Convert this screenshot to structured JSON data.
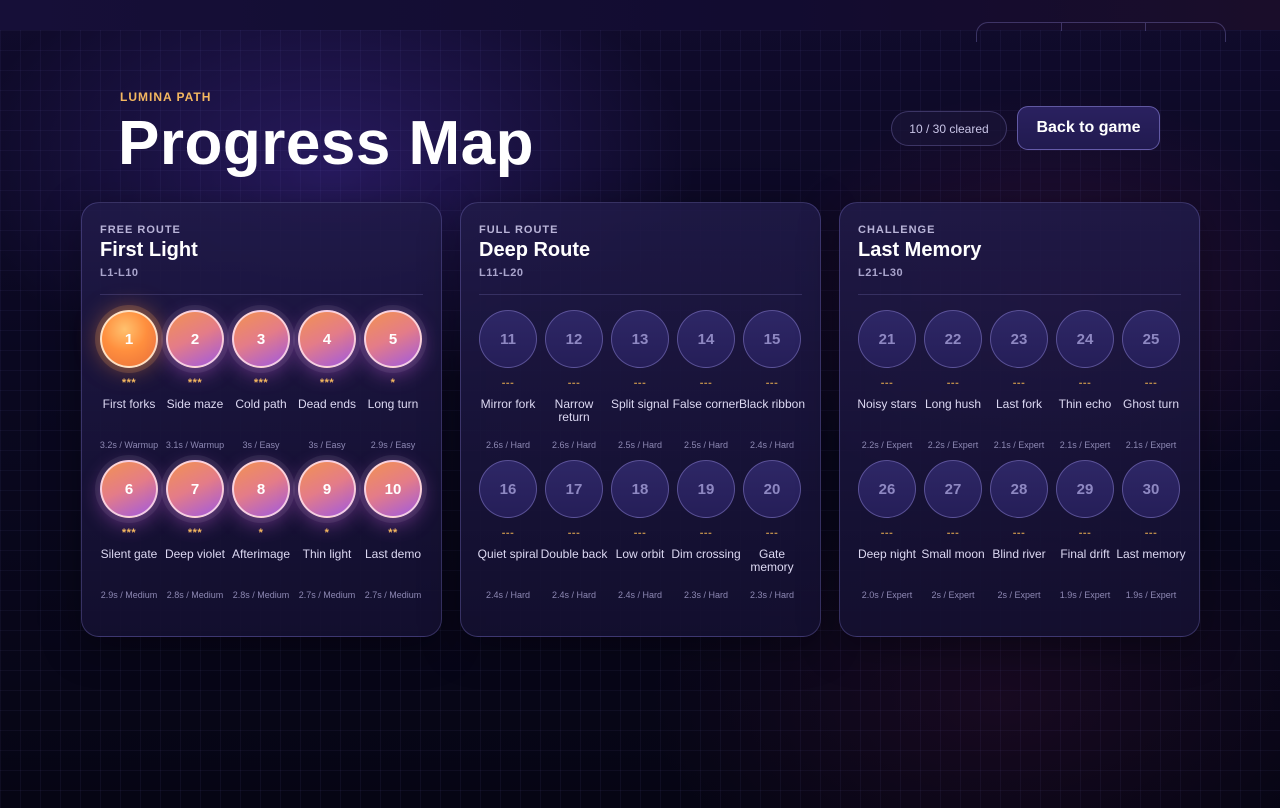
{
  "header": {
    "eyebrow": "LUMINA PATH",
    "title": "Progress Map",
    "cleared": "10 / 30 cleared",
    "back_label": "Back to game"
  },
  "colors": {
    "accent": "#f4b860",
    "cleared_node_start": "#f29252",
    "cleared_node_end": "#a05ae0",
    "current_node": "#ff8f3e",
    "locked_node": "#2e2766"
  },
  "panels": [
    {
      "kicker": "FREE ROUTE",
      "title": "First Light",
      "range": "L1-L10",
      "levels": [
        {
          "num": "1",
          "stars": "***",
          "name": "First forks",
          "meta": "3.2s / Warmup",
          "state": "current"
        },
        {
          "num": "2",
          "stars": "***",
          "name": "Side maze",
          "meta": "3.1s / Warmup",
          "state": "cleared"
        },
        {
          "num": "3",
          "stars": "***",
          "name": "Cold path",
          "meta": "3s / Easy",
          "state": "cleared"
        },
        {
          "num": "4",
          "stars": "***",
          "name": "Dead ends",
          "meta": "3s / Easy",
          "state": "cleared"
        },
        {
          "num": "5",
          "stars": "*",
          "name": "Long turn",
          "meta": "2.9s / Easy",
          "state": "cleared"
        },
        {
          "num": "6",
          "stars": "***",
          "name": "Silent gate",
          "meta": "2.9s / Medium",
          "state": "cleared"
        },
        {
          "num": "7",
          "stars": "***",
          "name": "Deep violet",
          "meta": "2.8s / Medium",
          "state": "cleared"
        },
        {
          "num": "8",
          "stars": "*",
          "name": "Afterimage",
          "meta": "2.8s / Medium",
          "state": "cleared"
        },
        {
          "num": "9",
          "stars": "*",
          "name": "Thin light",
          "meta": "2.7s / Medium",
          "state": "cleared"
        },
        {
          "num": "10",
          "stars": "**",
          "name": "Last demo",
          "meta": "2.7s / Medium",
          "state": "cleared"
        }
      ]
    },
    {
      "kicker": "FULL ROUTE",
      "title": "Deep Route",
      "range": "L11-L20",
      "levels": [
        {
          "num": "11",
          "stars": "---",
          "name": "Mirror fork",
          "meta": "2.6s / Hard",
          "state": "locked"
        },
        {
          "num": "12",
          "stars": "---",
          "name": "Narrow return",
          "meta": "2.6s / Hard",
          "state": "locked"
        },
        {
          "num": "13",
          "stars": "---",
          "name": "Split signal",
          "meta": "2.5s / Hard",
          "state": "locked"
        },
        {
          "num": "14",
          "stars": "---",
          "name": "False corner",
          "meta": "2.5s / Hard",
          "state": "locked"
        },
        {
          "num": "15",
          "stars": "---",
          "name": "Black ribbon",
          "meta": "2.4s / Hard",
          "state": "locked"
        },
        {
          "num": "16",
          "stars": "---",
          "name": "Quiet spiral",
          "meta": "2.4s / Hard",
          "state": "locked"
        },
        {
          "num": "17",
          "stars": "---",
          "name": "Double back",
          "meta": "2.4s / Hard",
          "state": "locked"
        },
        {
          "num": "18",
          "stars": "---",
          "name": "Low orbit",
          "meta": "2.4s / Hard",
          "state": "locked"
        },
        {
          "num": "19",
          "stars": "---",
          "name": "Dim crossing",
          "meta": "2.3s / Hard",
          "state": "locked"
        },
        {
          "num": "20",
          "stars": "---",
          "name": "Gate memory",
          "meta": "2.3s / Hard",
          "state": "locked"
        }
      ]
    },
    {
      "kicker": "CHALLENGE",
      "title": "Last Memory",
      "range": "L21-L30",
      "levels": [
        {
          "num": "21",
          "stars": "---",
          "name": "Noisy stars",
          "meta": "2.2s / Expert",
          "state": "locked"
        },
        {
          "num": "22",
          "stars": "---",
          "name": "Long hush",
          "meta": "2.2s / Expert",
          "state": "locked"
        },
        {
          "num": "23",
          "stars": "---",
          "name": "Last fork",
          "meta": "2.1s / Expert",
          "state": "locked"
        },
        {
          "num": "24",
          "stars": "---",
          "name": "Thin echo",
          "meta": "2.1s / Expert",
          "state": "locked"
        },
        {
          "num": "25",
          "stars": "---",
          "name": "Ghost turn",
          "meta": "2.1s / Expert",
          "state": "locked"
        },
        {
          "num": "26",
          "stars": "---",
          "name": "Deep night",
          "meta": "2.0s / Expert",
          "state": "locked"
        },
        {
          "num": "27",
          "stars": "---",
          "name": "Small moon",
          "meta": "2s / Expert",
          "state": "locked"
        },
        {
          "num": "28",
          "stars": "---",
          "name": "Blind river",
          "meta": "2s / Expert",
          "state": "locked"
        },
        {
          "num": "29",
          "stars": "---",
          "name": "Final drift",
          "meta": "1.9s / Expert",
          "state": "locked"
        },
        {
          "num": "30",
          "stars": "---",
          "name": "Last memory",
          "meta": "1.9s / Expert",
          "state": "locked"
        }
      ]
    }
  ]
}
